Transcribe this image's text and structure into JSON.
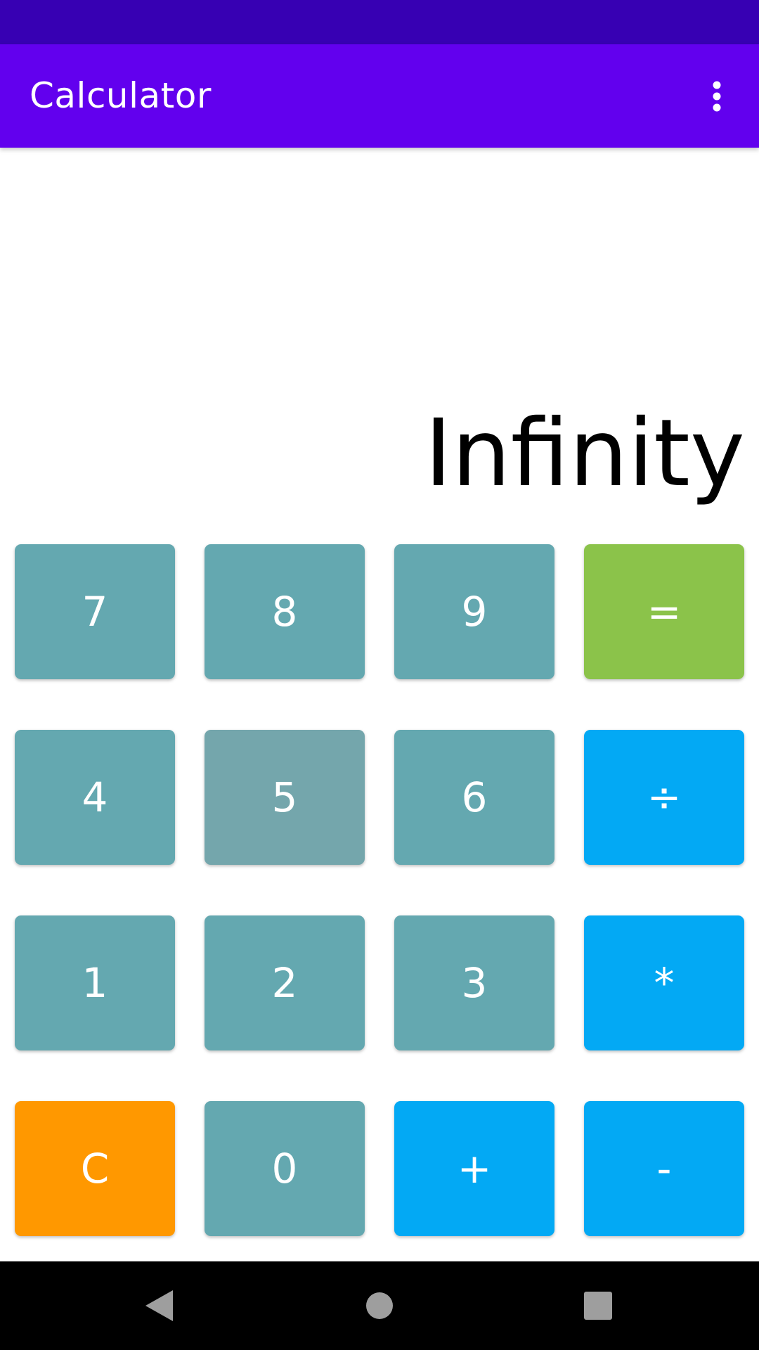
{
  "app": {
    "title": "Calculator",
    "menu_icon": "more-vert-icon"
  },
  "display": {
    "value": "Infinity"
  },
  "keys": [
    {
      "label": "7",
      "name": "key-7",
      "color": "#64a8b0"
    },
    {
      "label": "8",
      "name": "key-8",
      "color": "#64a8b0"
    },
    {
      "label": "9",
      "name": "key-9",
      "color": "#64a8b0"
    },
    {
      "label": "=",
      "name": "key-equals",
      "color": "#8bc34a"
    },
    {
      "label": "4",
      "name": "key-4",
      "color": "#64a8b0"
    },
    {
      "label": "5",
      "name": "key-5",
      "color": "#74a6ac"
    },
    {
      "label": "6",
      "name": "key-6",
      "color": "#64a8b0"
    },
    {
      "label": "÷",
      "name": "key-divide",
      "color": "#03a9f4"
    },
    {
      "label": "1",
      "name": "key-1",
      "color": "#64a8b0"
    },
    {
      "label": "2",
      "name": "key-2",
      "color": "#64a8b0"
    },
    {
      "label": "3",
      "name": "key-3",
      "color": "#64a8b0"
    },
    {
      "label": "*",
      "name": "key-multiply",
      "color": "#03a9f4"
    },
    {
      "label": "C",
      "name": "key-clear",
      "color": "#ff9800"
    },
    {
      "label": "0",
      "name": "key-0",
      "color": "#64a8b0"
    },
    {
      "label": "+",
      "name": "key-plus",
      "color": "#03a9f4"
    },
    {
      "label": "-",
      "name": "key-minus",
      "color": "#03a9f4"
    }
  ],
  "navigation": {
    "back_icon": "back-triangle-icon",
    "home_icon": "home-circle-icon",
    "recents_icon": "recents-square-icon"
  },
  "colors": {
    "status_bar": "#3700b3",
    "app_bar": "#6200ee",
    "digit_key": "#64a8b0",
    "operator_key": "#03a9f4",
    "equals_key": "#8bc34a",
    "clear_key": "#ff9800"
  }
}
